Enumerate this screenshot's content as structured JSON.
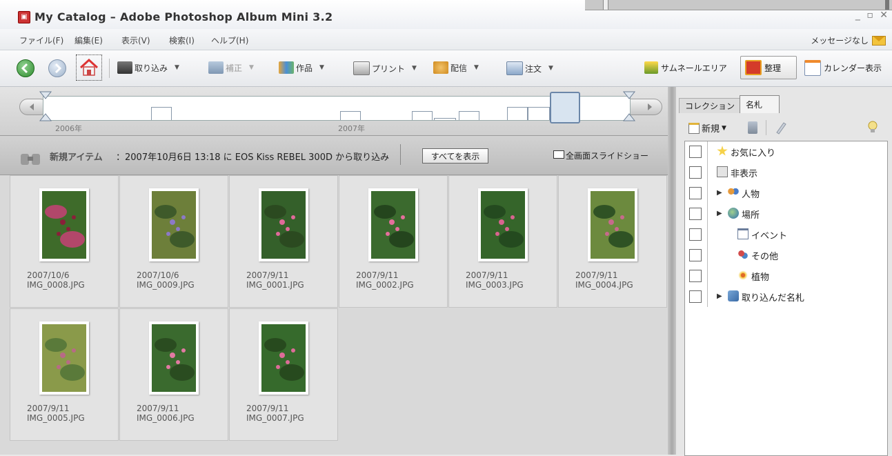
{
  "window": {
    "title": "My Catalog – Adobe Photoshop Album Mini 3.2",
    "controls": [
      "_",
      "▫",
      "✕"
    ]
  },
  "menu": {
    "items": [
      "ファイル(F)",
      "編集(E)",
      "表示(V)",
      "検索(I)",
      "ヘルプ(H)"
    ],
    "message_status": "メッセージなし"
  },
  "toolbar": {
    "import": "取り込み",
    "fix": "補正",
    "create": "作品",
    "print": "プリント",
    "share": "配信",
    "order": "注文",
    "thumbnail_area": "サムネールエリア",
    "organize": "整理",
    "calendar": "カレンダー表示"
  },
  "timeline": {
    "label_2006": "2006年",
    "label_2007": "2007年"
  },
  "infobar": {
    "heading": "新規アイテム",
    "text": "：2007年10月6日 13:18 に EOS Kiss REBEL 300D から取り込み",
    "show_all": "すべてを表示",
    "slideshow": "全画面スライドショー"
  },
  "photos": [
    {
      "date": "2007/10/6",
      "file": "IMG_0008.JPG"
    },
    {
      "date": "2007/10/6",
      "file": "IMG_0009.JPG"
    },
    {
      "date": "2007/9/11",
      "file": "IMG_0001.JPG"
    },
    {
      "date": "2007/9/11",
      "file": "IMG_0002.JPG"
    },
    {
      "date": "2007/9/11",
      "file": "IMG_0003.JPG"
    },
    {
      "date": "2007/9/11",
      "file": "IMG_0004.JPG"
    },
    {
      "date": "2007/9/11",
      "file": "IMG_0005.JPG"
    },
    {
      "date": "2007/9/11",
      "file": "IMG_0006.JPG"
    },
    {
      "date": "2007/9/11",
      "file": "IMG_0007.JPG"
    }
  ],
  "panel": {
    "tab_collection": "コレクション",
    "tab_tags": "名札",
    "new_button": "新規",
    "tags": [
      {
        "label": "お気に入り",
        "icon": "star-icon"
      },
      {
        "label": "非表示",
        "icon": "hidden-icon"
      },
      {
        "label": "人物",
        "icon": "people-icon"
      },
      {
        "label": "場所",
        "icon": "globe-icon"
      },
      {
        "label": "イベント",
        "icon": "calendar-icon"
      },
      {
        "label": "その他",
        "icon": "other-icon"
      },
      {
        "label": "植物",
        "icon": "flower-icon"
      },
      {
        "label": "取り込んだ名札",
        "icon": "imported-tag-icon"
      }
    ]
  }
}
